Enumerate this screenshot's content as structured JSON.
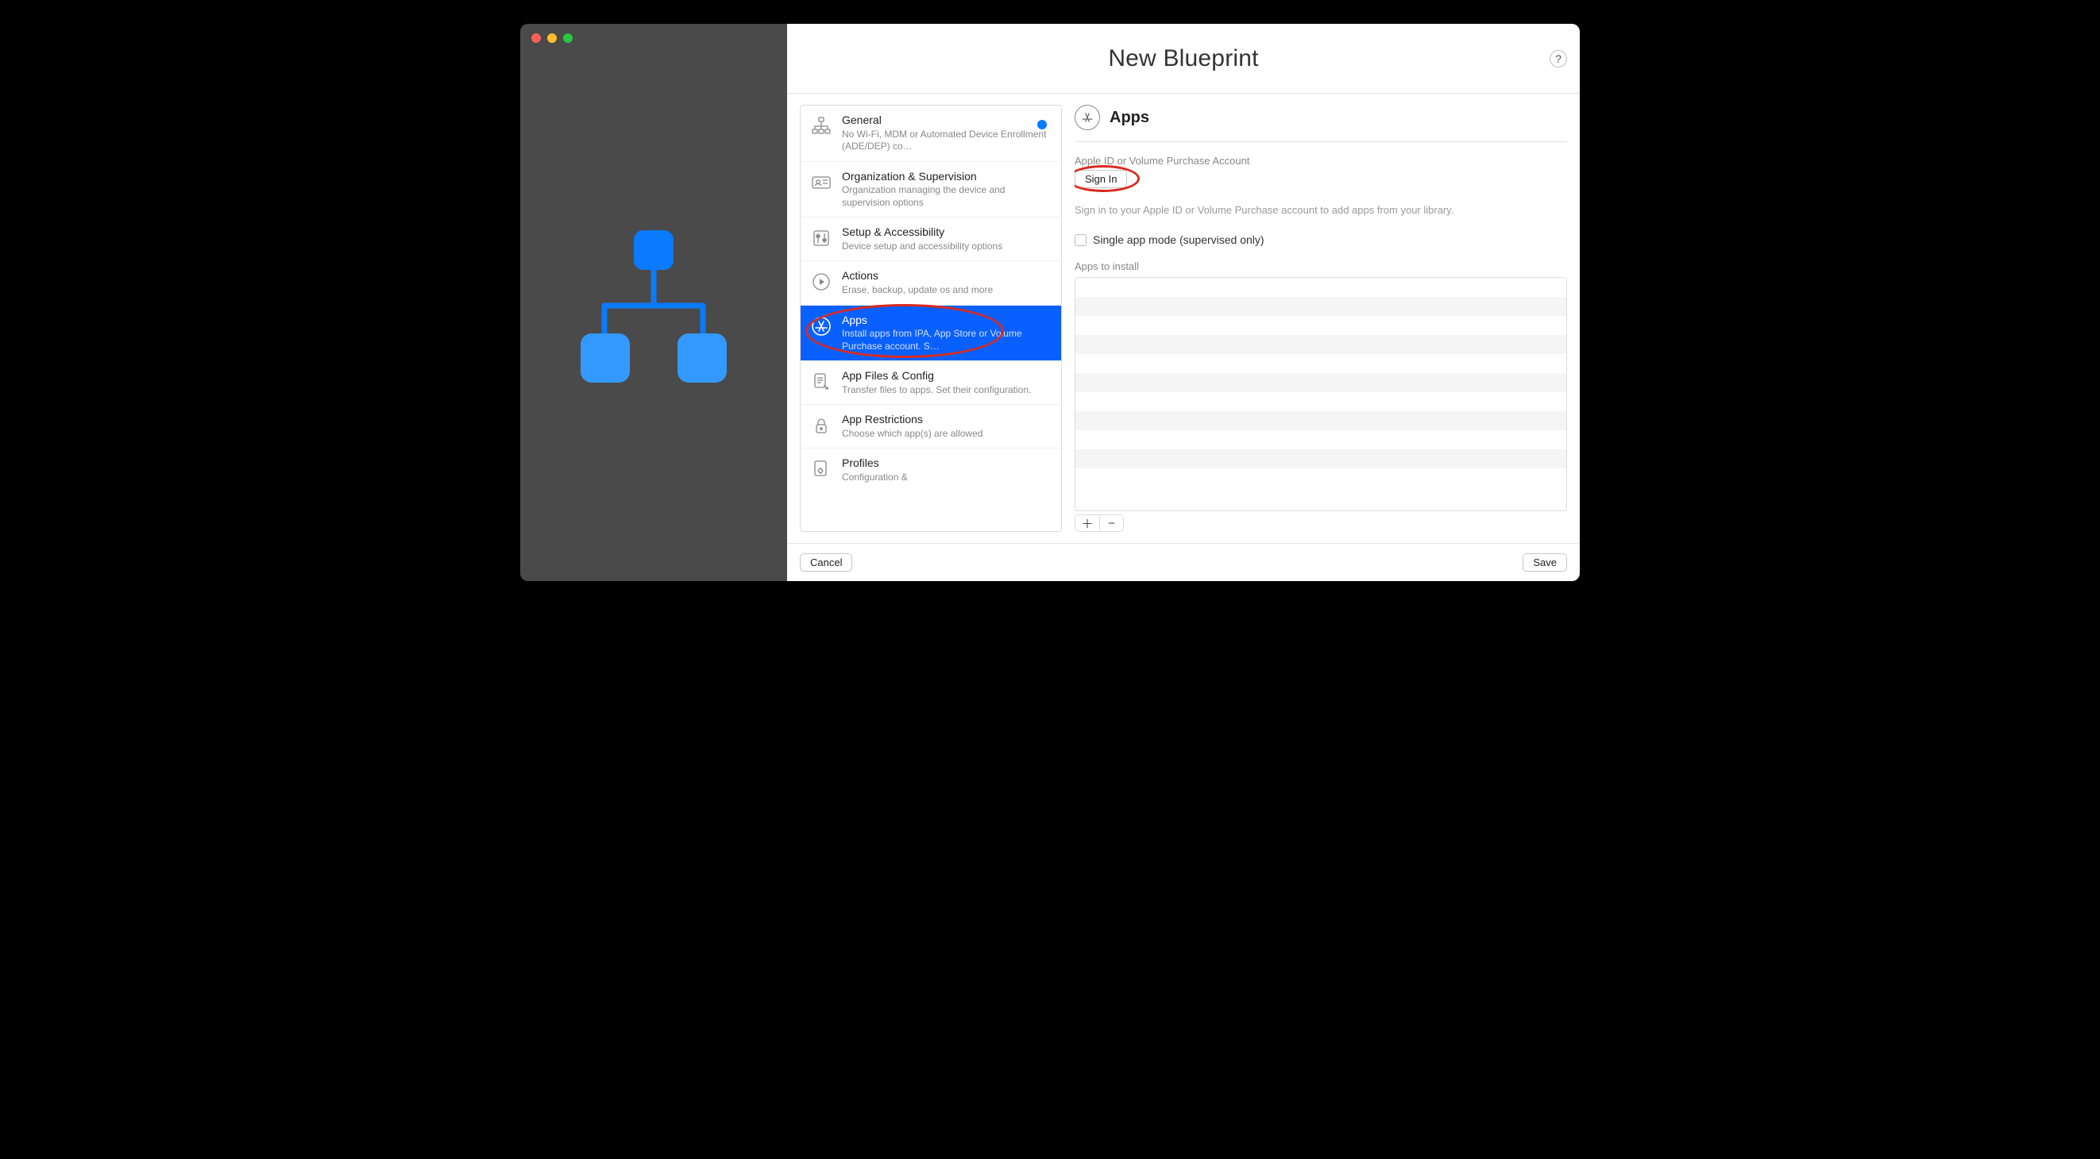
{
  "window": {
    "title": "New Blueprint"
  },
  "sidebar": {
    "items": [
      {
        "title": "General",
        "sub": "No Wi-Fi, MDM or Automated Device Enrollment (ADE/DEP) co…",
        "badge": true
      },
      {
        "title": "Organization & Supervision",
        "sub": "Organization managing the device and supervision options"
      },
      {
        "title": "Setup & Accessibility",
        "sub": "Device setup and accessibility options"
      },
      {
        "title": "Actions",
        "sub": "Erase, backup, update os and more"
      },
      {
        "title": "Apps",
        "sub": "Install apps from IPA, App Store or Volume Purchase account. S…",
        "selected": true
      },
      {
        "title": "App Files & Config",
        "sub": "Transfer files to apps. Set their configuration."
      },
      {
        "title": "App Restrictions",
        "sub": "Choose which app(s) are allowed"
      },
      {
        "title": "Profiles",
        "sub": "Configuration &"
      }
    ]
  },
  "detail": {
    "title": "Apps",
    "account_label": "Apple ID or Volume Purchase Account",
    "signin_label": "Sign In",
    "signin_hint": "Sign in to your Apple ID or Volume Purchase account to add apps from your library.",
    "single_app_label": "Single app mode (supervised only)",
    "apps_to_install_label": "Apps to install"
  },
  "footer": {
    "cancel": "Cancel",
    "save": "Save"
  },
  "help_label": "?"
}
